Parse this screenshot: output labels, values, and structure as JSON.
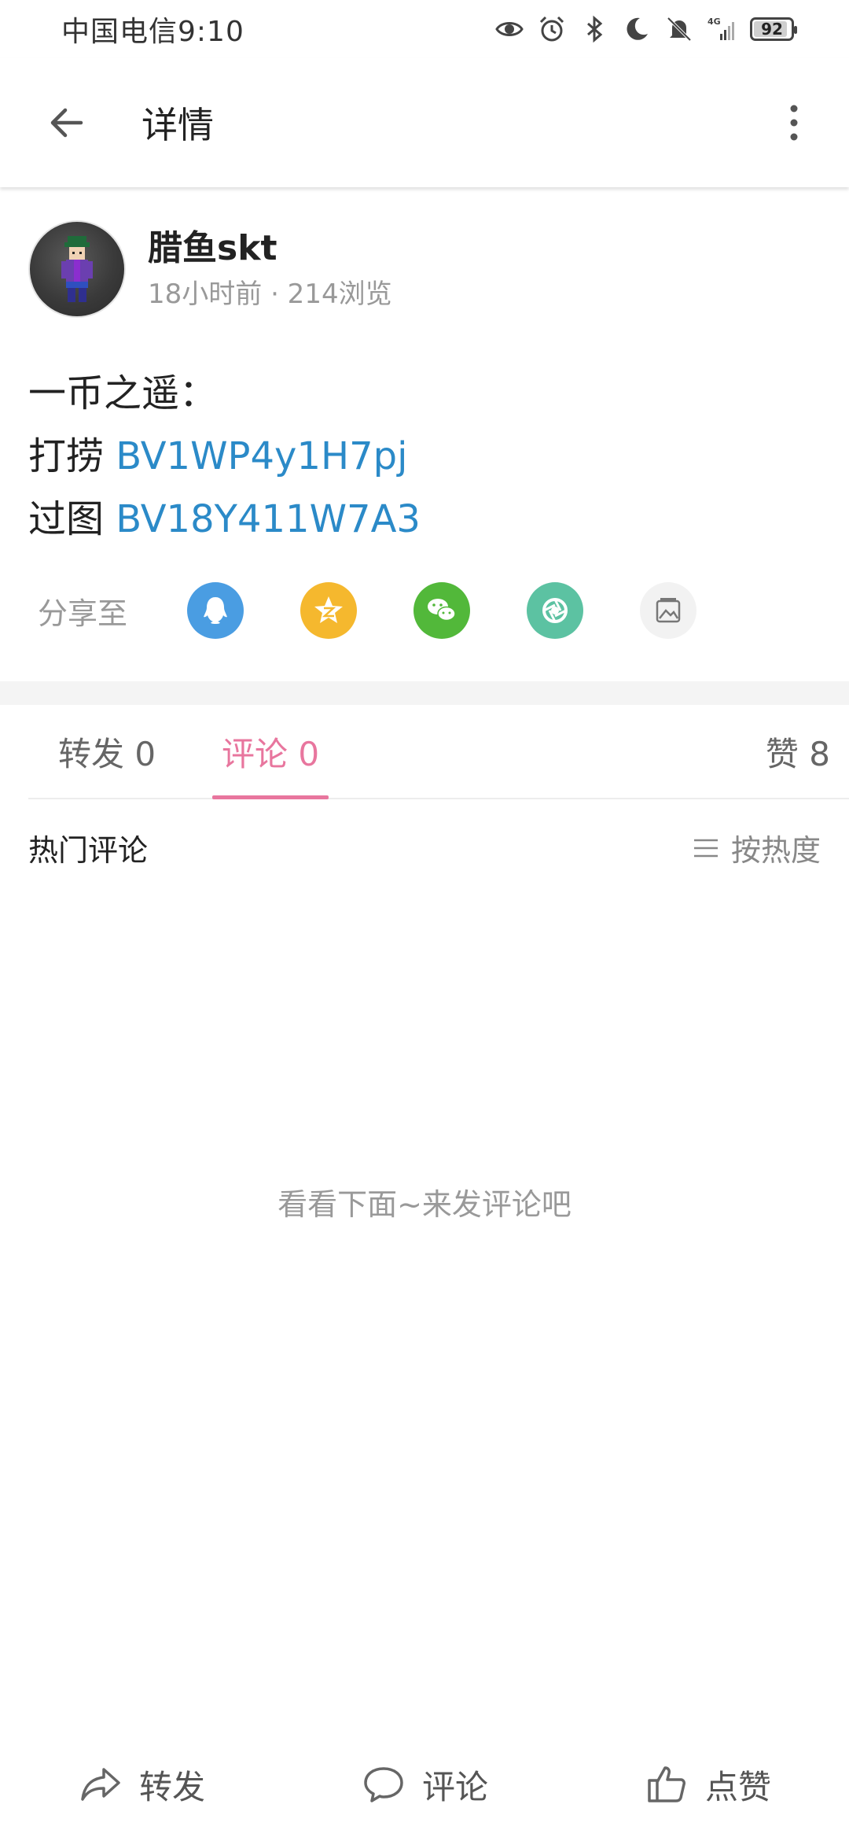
{
  "status_bar": {
    "carrier_time": "中国电信9:10",
    "battery": "92",
    "battery_level": 0.92,
    "network": "4G",
    "icons": [
      "eye-icon",
      "alarm-icon",
      "bluetooth-icon",
      "moon-icon",
      "mute-bell-icon",
      "signal-icon",
      "battery-icon"
    ]
  },
  "app_bar": {
    "title": "详情",
    "back_icon": "arrow-left-icon",
    "more_icon": "more-vertical-icon"
  },
  "author": {
    "name": "腊鱼skt",
    "meta": "18小时前 · 214浏览"
  },
  "post": {
    "line1": "一币之遥：",
    "line2_text": "打捞 ",
    "line2_link": "BV1WP4y1H7pj",
    "line3_text": "过图 ",
    "line3_link": "BV18Y411W7A3",
    "link_color": "#2b8ac8"
  },
  "share": {
    "label": "分享至",
    "targets": [
      {
        "name": "qq",
        "icon": "qq-penguin-icon",
        "color": "#4a9de2"
      },
      {
        "name": "qzone",
        "icon": "qzone-star-icon",
        "color": "#f5b82e"
      },
      {
        "name": "wechat",
        "icon": "wechat-icon",
        "color": "#52b83a"
      },
      {
        "name": "moments",
        "icon": "moments-shutter-icon",
        "color": "#5cc2a2"
      },
      {
        "name": "image",
        "icon": "image-icon",
        "color": "#f2f2f2"
      }
    ]
  },
  "tabs": [
    {
      "label": "转发 0",
      "active": false
    },
    {
      "label": "评论 0",
      "active": true
    },
    {
      "label": "赞 8",
      "active": false
    }
  ],
  "accent_color": "#e8769e",
  "comments": {
    "section_title": "热门评论",
    "sort_label": "按热度",
    "empty_hint": "看看下面~来发评论吧"
  },
  "bottom_actions": [
    {
      "label": "转发",
      "icon": "share-arrow-icon"
    },
    {
      "label": "评论",
      "icon": "comment-bubble-icon"
    },
    {
      "label": "点赞",
      "icon": "thumbs-up-icon"
    }
  ]
}
